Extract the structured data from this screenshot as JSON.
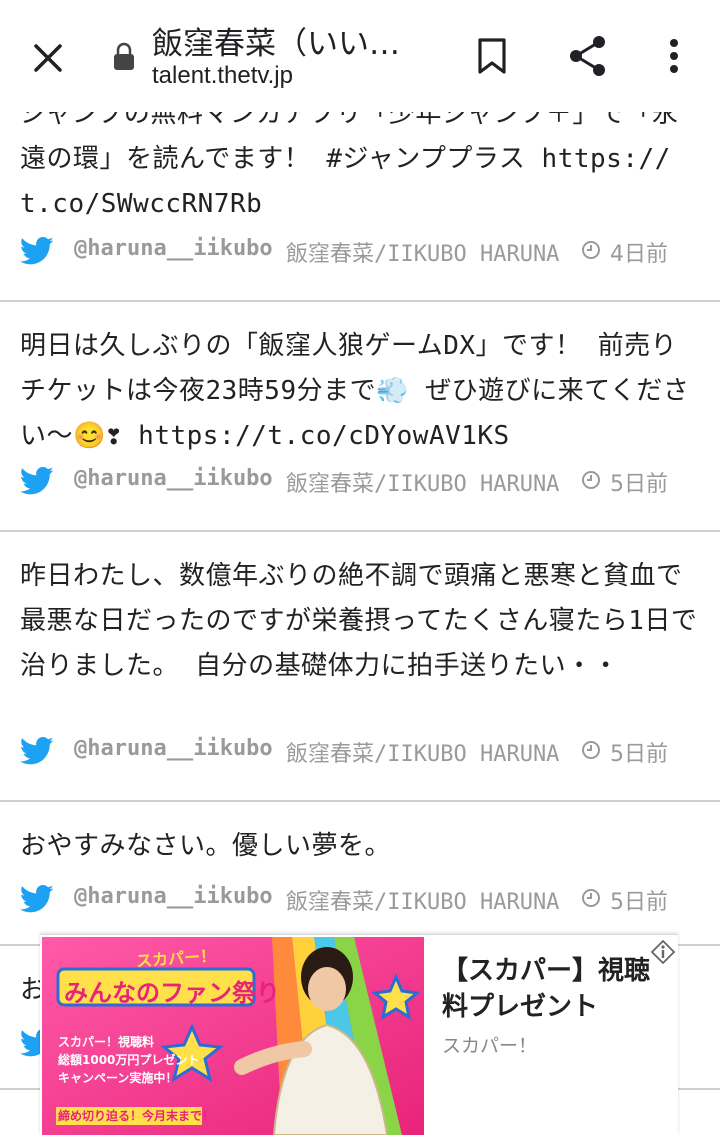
{
  "browser": {
    "title": "飯窪春菜（いい…",
    "url": "talent.thetv.jp"
  },
  "tweets": [
    {
      "text": "ジャンプの無料マンガアプリ「少年ジャンプ＋」で「永遠の環」を読んでます！ #ジャンププラス https://t.co/SWwccRN7Rb",
      "handle": "@haruna__iikubo",
      "name": "飯窪春菜/IIKUBO HARUNA",
      "time": "4日前"
    },
    {
      "text": "明日は久しぶりの「飯窪人狼ゲームDX」です！ 前売りチケットは今夜23時59分まで💨 ぜひ遊びに来てください～😊❣ https://t.co/cDYowAV1KS",
      "handle": "@haruna__iikubo",
      "name": "飯窪春菜/IIKUBO HARUNA",
      "time": "5日前"
    },
    {
      "text": "昨日わたし、数億年ぶりの絶不調で頭痛と悪寒と貧血で最悪な日だったのですが栄養摂ってたくさん寝たら1日で治りました。 自分の基礎体力に拍手送りたい・・",
      "handle": "@haruna__iikubo",
      "name": "飯窪春菜/IIKUBO HARUNA",
      "time": "5日前"
    },
    {
      "text": "おやすみなさい。優しい夢を。",
      "handle": "@haruna__iikubo",
      "name": "飯窪春菜/IIKUBO HARUNA",
      "time": "5日前"
    },
    {
      "text": "お",
      "handle": "",
      "name": "",
      "time": ""
    }
  ],
  "ad": {
    "brand": "スカパー！",
    "banner_heading": "みんなのファン祭り",
    "banner_lines": [
      "スカパー！視聴料",
      "総額1000万円プレゼント",
      "キャンペーン実施中！",
      "締め切り迫る！今月末まで！"
    ],
    "title": "【スカパー】視聴料プレゼント",
    "source": "スカパー！"
  },
  "colors": {
    "twitter_blue": "#1da1f2",
    "meta_gray": "#9a9a9a",
    "divider": "#cfcfcf",
    "ad_pink": "#f0428e"
  }
}
